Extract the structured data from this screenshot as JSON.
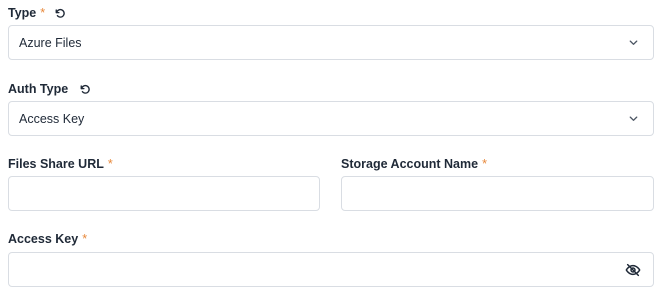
{
  "type_field": {
    "label": "Type",
    "required_mark": "*",
    "selected": "Azure Files"
  },
  "auth_type_field": {
    "label": "Auth Type",
    "selected": "Access Key"
  },
  "files_share_url_field": {
    "label": "Files Share URL",
    "required_mark": "*",
    "value": "",
    "placeholder": ""
  },
  "storage_account_name_field": {
    "label": "Storage Account Name",
    "required_mark": "*",
    "value": "",
    "placeholder": ""
  },
  "access_key_field": {
    "label": "Access Key",
    "required_mark": "*",
    "value": "",
    "placeholder": ""
  },
  "icons": {
    "reset": "reset-icon",
    "chevron": "chevron-down-icon",
    "visibility": "eye-off-icon"
  },
  "colors": {
    "required": "#e8883a",
    "border": "#d9dde3",
    "text": "#1f2937"
  }
}
